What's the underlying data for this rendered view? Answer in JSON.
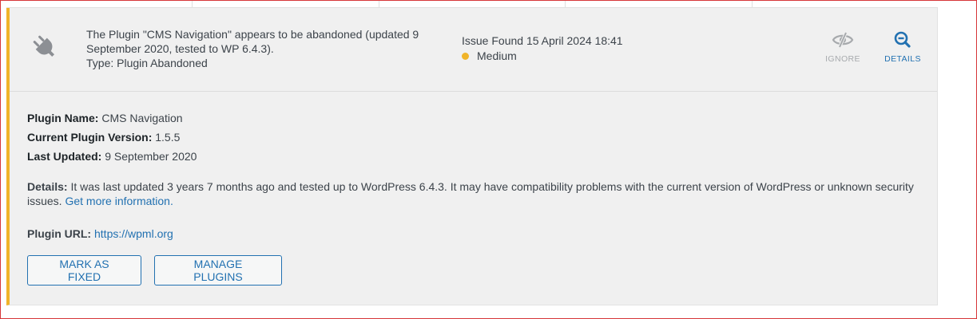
{
  "issue": {
    "summary_line1": "The Plugin \"CMS Navigation\" appears to be abandoned (updated 9",
    "summary_line2": "September 2020, tested to WP 6.4.3).",
    "type_text": "Type: Plugin Abandoned",
    "found_text": "Issue Found 15 April 2024 18:41",
    "severity": "Medium",
    "severity_color": "#f0b429"
  },
  "actions": {
    "ignore_label": "IGNORE",
    "details_label": "DETAILS"
  },
  "details": {
    "plugin_name_label": "Plugin Name:",
    "plugin_name": "CMS Navigation",
    "version_label": "Current Plugin Version:",
    "version": "1.5.5",
    "updated_label": "Last Updated:",
    "updated": "9 September 2020",
    "details_label": "Details:",
    "details_text": "It was last updated 3 years 7 months ago and tested up to WordPress 6.4.3. It may have compatibility problems with the current version of WordPress or unknown security issues.",
    "more_info_link": "Get more information.",
    "url_label": "Plugin URL:",
    "url": "https://wpml.org"
  },
  "buttons": {
    "mark_fixed": "MARK AS FIXED",
    "manage_plugins": "MANAGE PLUGINS"
  },
  "icons": {
    "plugin": "plug-icon",
    "ignore": "eye-slash-icon",
    "details": "zoom-out-icon"
  },
  "colors": {
    "accent": "#2271b1",
    "warning": "#f0b429",
    "frame": "#d63638"
  }
}
